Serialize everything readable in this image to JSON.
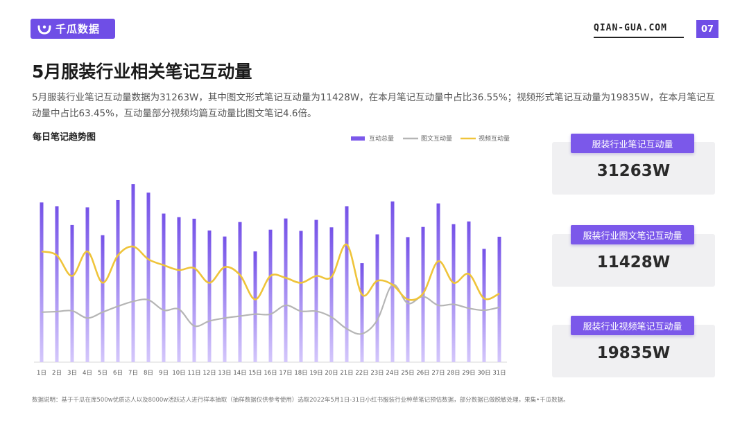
{
  "header": {
    "logo_text": "千瓜数据",
    "site": "QIAN-GUA.COM",
    "page_number": "07",
    "brand_color": "#6f4ee6"
  },
  "title": "5月服装行业相关笔记互动量",
  "description": "5月服装行业笔记互动量数据为31263W，其中图文形式笔记互动量为11428W，在本月笔记互动量中占比36.55%；视频形式笔记互动量为19835W，在本月笔记互动量中占比63.45%，互动量部分视频均篇互动量比图文笔记4.6倍。",
  "chart_title": "每日笔记趋势图",
  "kpis": [
    {
      "label": "服装行业笔记互动量",
      "value": "31263W"
    },
    {
      "label": "服装行业图文笔记互动量",
      "value": "11428W"
    },
    {
      "label": "服装行业视频笔记互动量",
      "value": "19835W"
    }
  ],
  "footnote": "数据说明：基于千瓜在库500w优质达人以及8000w活跃达人进行样本抽取（抽样数据仅供参考使用）选取2022年5月1日-31日小红书服装行业种草笔记预估数据，部分数据已做脱敏处理，果集•千瓜数据。",
  "chart_data": {
    "type": "bar",
    "categories": [
      "1日",
      "2日",
      "3日",
      "4日",
      "5日",
      "6日",
      "7日",
      "8日",
      "9日",
      "10日",
      "11日",
      "12日",
      "13日",
      "14日",
      "15日",
      "16日",
      "17日",
      "18日",
      "19日",
      "20日",
      "21日",
      "22日",
      "23日",
      "24日",
      "25日",
      "26日",
      "27日",
      "28日",
      "29日",
      "30日",
      "31日"
    ],
    "ylim": [
      0,
      1000
    ],
    "series": [
      {
        "name": "互动总量",
        "type": "bar",
        "color": "#7b58ea",
        "values": [
          815,
          795,
          700,
          790,
          648,
          827,
          908,
          865,
          758,
          740,
          732,
          672,
          641,
          715,
          565,
          676,
          733,
          670,
          726,
          688,
          795,
          505,
          652,
          820,
          638,
          690,
          810,
          704,
          718,
          578,
          640
        ]
      },
      {
        "name": "图文互动量",
        "type": "line",
        "color": "#b5b5b5",
        "values": [
          255,
          258,
          262,
          225,
          255,
          285,
          310,
          318,
          265,
          270,
          185,
          210,
          225,
          235,
          245,
          245,
          290,
          260,
          260,
          230,
          170,
          145,
          215,
          395,
          300,
          335,
          290,
          295,
          275,
          265,
          280
        ]
      },
      {
        "name": "视频互动量",
        "type": "line",
        "color": "#efc43a",
        "values": [
          565,
          545,
          440,
          565,
          405,
          545,
          590,
          525,
          495,
          470,
          480,
          405,
          485,
          445,
          320,
          440,
          430,
          405,
          440,
          435,
          600,
          345,
          415,
          395,
          320,
          350,
          515,
          405,
          450,
          325,
          350
        ]
      }
    ]
  }
}
